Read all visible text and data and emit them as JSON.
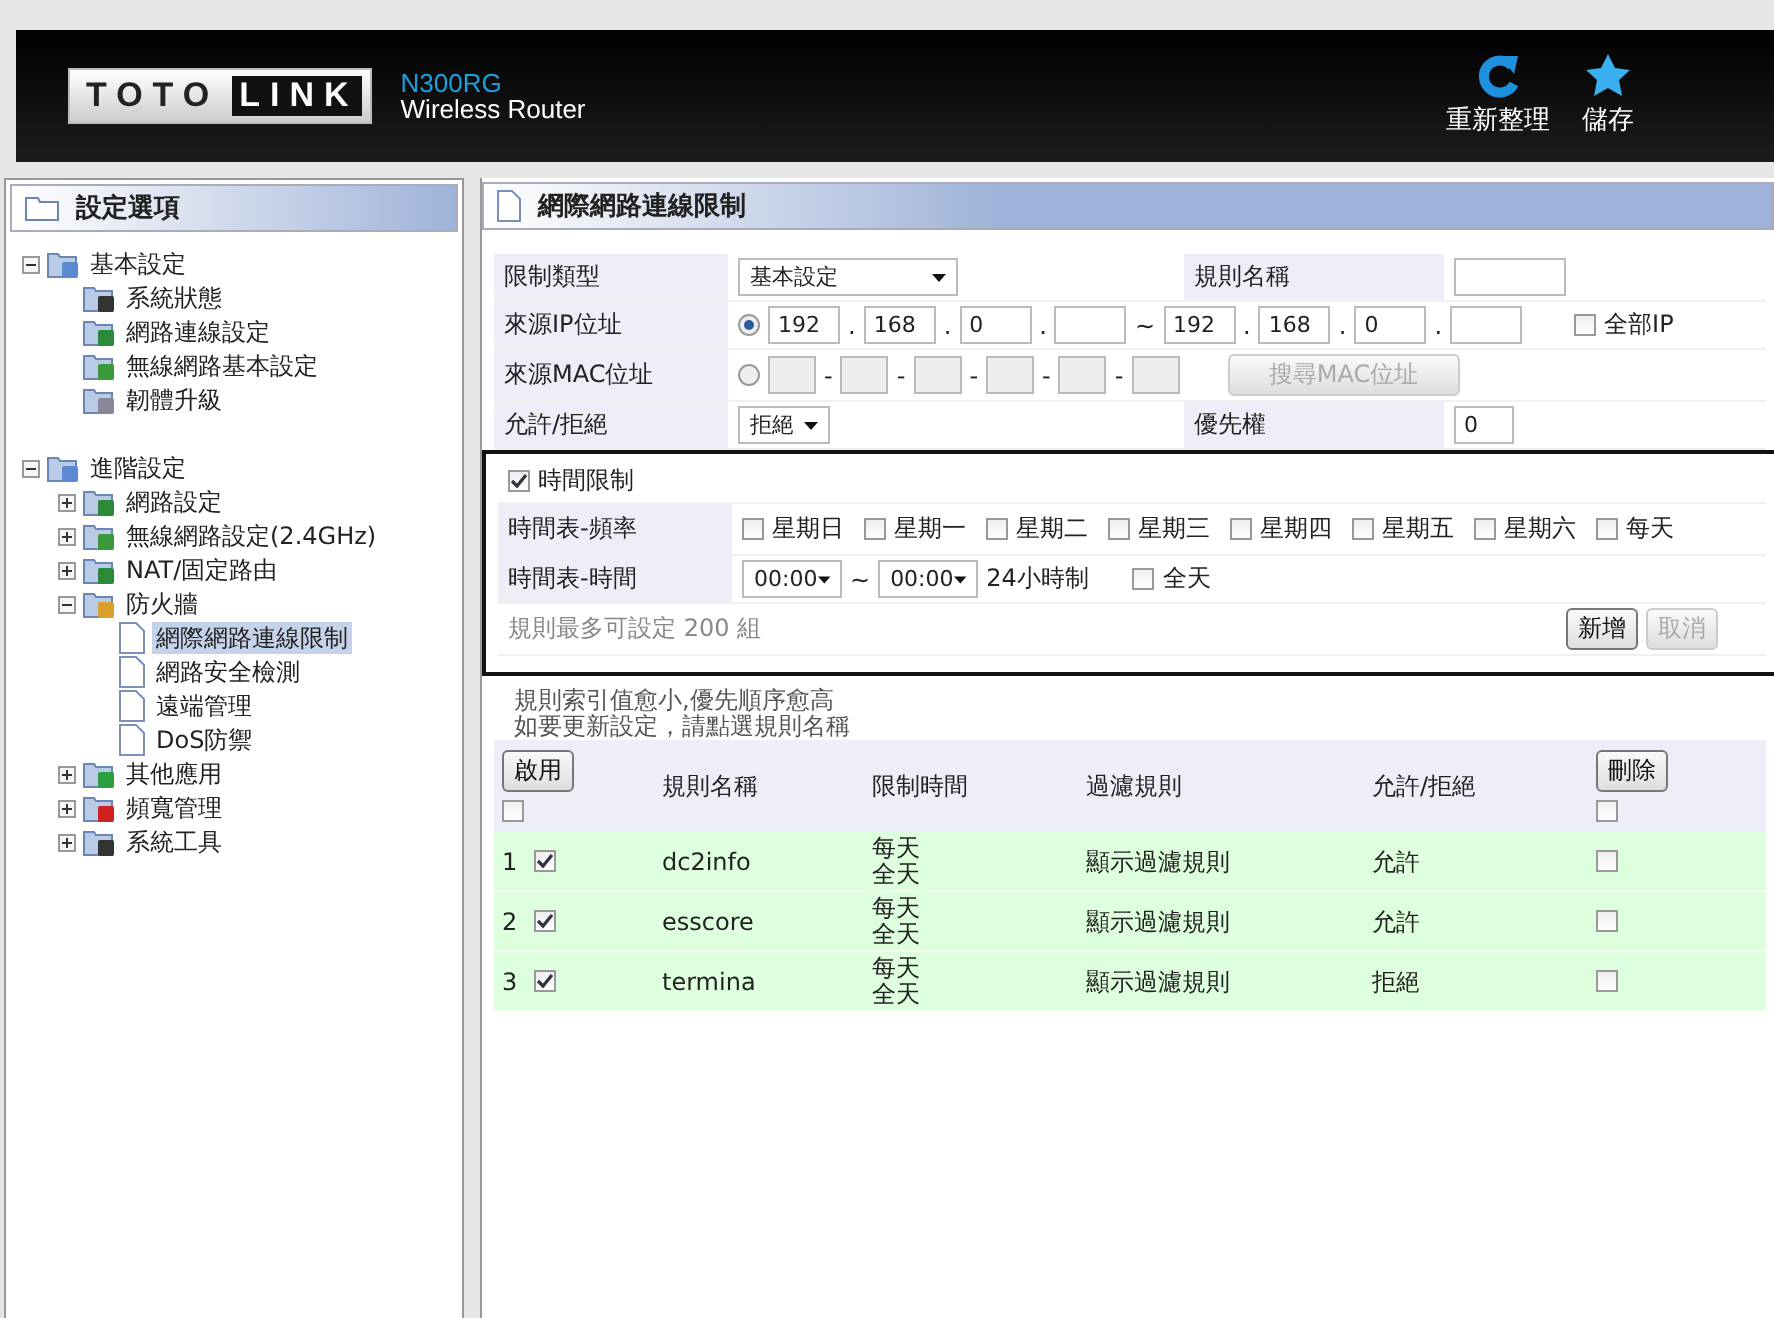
{
  "header": {
    "logo": [
      "TOTO",
      "LINK"
    ],
    "model": "N300RG",
    "subtitle": "Wireless Router",
    "actions": [
      {
        "kind": "refresh",
        "label": "重新整理"
      },
      {
        "kind": "save",
        "label": "儲存"
      }
    ]
  },
  "sidebar": {
    "title": "設定選項",
    "tree": [
      {
        "label": "基本設定",
        "expanded": true,
        "children": [
          {
            "label": "系統狀態"
          },
          {
            "label": "網路連線設定"
          },
          {
            "label": "無線網路基本設定"
          },
          {
            "label": "韌體升級"
          }
        ]
      },
      {
        "label": "進階設定",
        "expanded": true,
        "children": [
          {
            "label": "網路設定",
            "expanded": false
          },
          {
            "label": "無線網路設定(2.4GHz)",
            "expanded": false
          },
          {
            "label": "NAT/固定路由",
            "expanded": false
          },
          {
            "label": "防火牆",
            "expanded": true,
            "children": [
              {
                "label": "網際網路連線限制",
                "selected": true
              },
              {
                "label": "網路安全檢測",
                "selected": false
              },
              {
                "label": "遠端管理",
                "selected": false
              },
              {
                "label": "DoS防禦",
                "selected": false
              }
            ]
          },
          {
            "label": "其他應用",
            "expanded": false
          },
          {
            "label": "頻寬管理",
            "expanded": false
          },
          {
            "label": "系統工具",
            "expanded": false
          }
        ]
      }
    ]
  },
  "main": {
    "title": "網際網路連線限制",
    "rule_type": {
      "label": "限制類型",
      "value": "基本設定"
    },
    "rule_name": {
      "label": "規則名稱"
    },
    "source_ip": {
      "label": "來源IP位址",
      "selected": true,
      "dot": ".",
      "tilde": "~",
      "from": [
        "192",
        "168",
        "0"
      ],
      "to": [
        "192",
        "168",
        "0"
      ]
    },
    "all_ip": {
      "label": "全部IP",
      "checked": false
    },
    "source_mac": {
      "label": "來源MAC位址",
      "selected": false,
      "dash": "-"
    },
    "mac_search": {
      "label": "搜尋MAC位址",
      "disabled": true
    },
    "allow_deny": {
      "label": "允許/拒絕",
      "value": "拒絕"
    },
    "priority": {
      "label": "優先權",
      "value": "0"
    },
    "time_limit": {
      "label": "時間限制",
      "checked": true
    },
    "frequency": {
      "label": "時間表-頻率",
      "days": [
        {
          "label": "星期日",
          "checked": false
        },
        {
          "label": "星期一",
          "checked": false
        },
        {
          "label": "星期二",
          "checked": false
        },
        {
          "label": "星期三",
          "checked": false
        },
        {
          "label": "星期四",
          "checked": false
        },
        {
          "label": "星期五",
          "checked": false
        },
        {
          "label": "星期六",
          "checked": false
        },
        {
          "label": "每天",
          "checked": false
        }
      ]
    },
    "time": {
      "label": "時間表-時間",
      "from": "00:00",
      "tilde": "~",
      "to": "00:00",
      "note": "24小時制",
      "all_day": {
        "label": "全天",
        "checked": false
      }
    },
    "limit_note": "規則最多可設定 200 組",
    "buttons": [
      {
        "label": "新增",
        "disabled": false
      },
      {
        "label": "取消",
        "disabled": true
      }
    ],
    "notes": [
      "規則索引值愈小,優先順序愈高",
      "如要更新設定，請點選規則名稱"
    ],
    "table": {
      "enable_button": "啟用",
      "delete_button": "刪除",
      "enable_all": false,
      "delete_all": false,
      "columns": [
        "規則名稱",
        "限制時間",
        "過濾規則",
        "允許/拒絕"
      ],
      "rows": [
        {
          "index": "1",
          "enabled": true,
          "name": "dc2info",
          "time": [
            "每天",
            "全天"
          ],
          "filter": "顯示過濾規則",
          "action": "允許",
          "delete": false
        },
        {
          "index": "2",
          "enabled": true,
          "name": "esscore",
          "time": [
            "每天",
            "全天"
          ],
          "filter": "顯示過濾規則",
          "action": "允許",
          "delete": false
        },
        {
          "index": "3",
          "enabled": true,
          "name": "termina",
          "time": [
            "每天",
            "全天"
          ],
          "filter": "顯示過濾規則",
          "action": "拒絕",
          "delete": false
        }
      ]
    }
  }
}
